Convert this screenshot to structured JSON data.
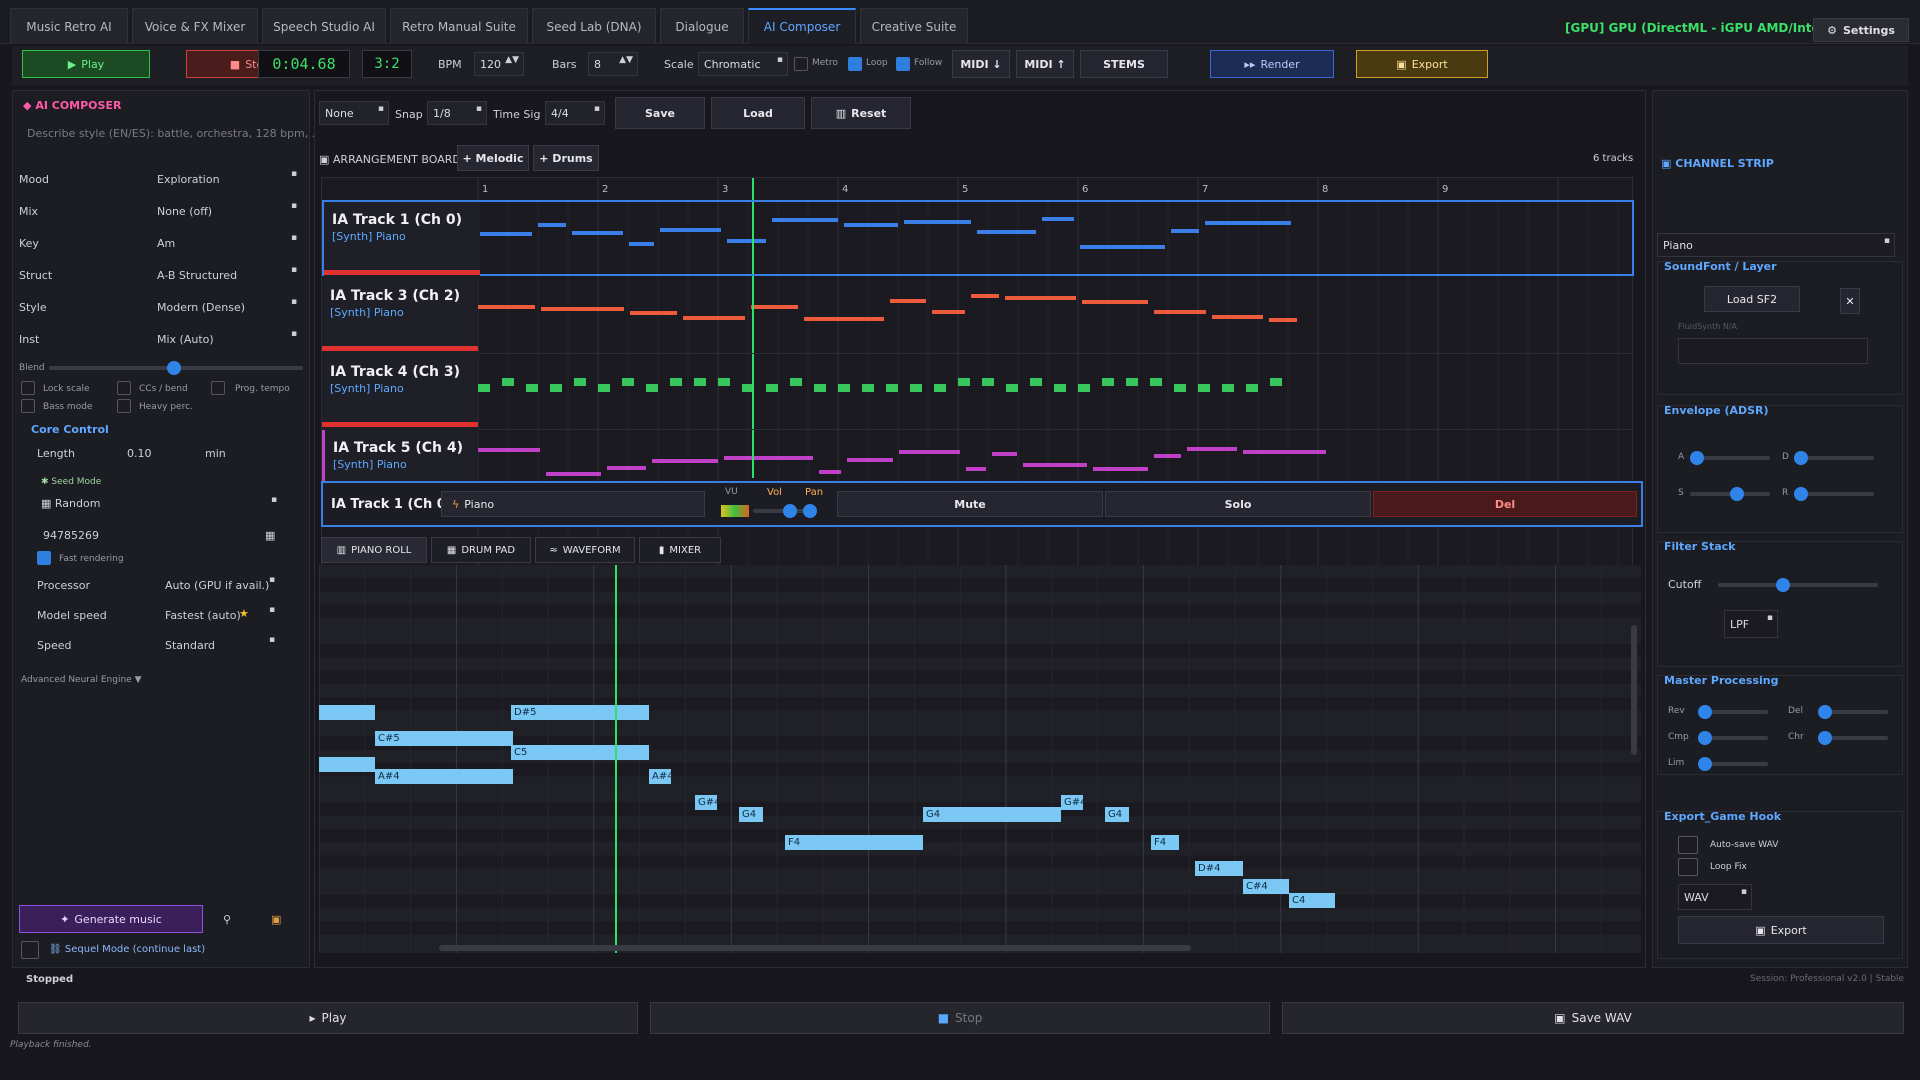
{
  "tabs": [
    {
      "label": "Music Retro AI"
    },
    {
      "label": "Voice & FX Mixer"
    },
    {
      "label": "Speech Studio AI"
    },
    {
      "label": "Retro Manual Suite"
    },
    {
      "label": "Seed Lab (DNA)"
    },
    {
      "label": "Dialogue"
    },
    {
      "label": "AI Composer"
    },
    {
      "label": "Creative Suite"
    }
  ],
  "gpu_status": "[GPU] GPU (DirectML - iGPU AMD/Intel)",
  "settings_label": "Settings",
  "toolbar": {
    "play": "Play",
    "stop": "Stop",
    "time": "0:04.68",
    "ratio": "3:2",
    "bpm_label": "BPM",
    "bpm": "120",
    "bars_label": "Bars",
    "bars": "8",
    "scale_label": "Scale",
    "scale": "Chromatic",
    "metro": "Metro",
    "loop": "Loop",
    "follow": "Follow",
    "midi_in": "MIDI ↓",
    "midi_out": "MIDI ↑",
    "stems": "STEMS",
    "render": "Render",
    "export": "Export"
  },
  "left": {
    "title": "AI COMPOSER",
    "prompt_placeholder": "Describe style (EN/ES): battle, orchestra, 128 bpm, ...",
    "rows": [
      {
        "label": "Mood",
        "value": "Exploration"
      },
      {
        "label": "Mix",
        "value": "None (off)"
      },
      {
        "label": "Key",
        "value": "Am"
      },
      {
        "label": "Struct",
        "value": "A-B Structured"
      },
      {
        "label": "Style",
        "value": "Modern (Dense)"
      },
      {
        "label": "Inst",
        "value": "Mix (Auto)"
      }
    ],
    "blend_label": "Blend",
    "blend_value": 0.5,
    "checks": [
      "Lock scale",
      "CCs / bend",
      "Prog. tempo",
      "Bass mode",
      "Heavy perc."
    ],
    "core_control": "Core Control",
    "length_label": "Length",
    "length_value": "0.10",
    "length_unit": "min",
    "seed_mode": "Seed Mode",
    "seed_type": "Random",
    "seed_value": "94785269",
    "fast_rendering": "Fast rendering",
    "processor_label": "Processor",
    "processor_value": "Auto (GPU if avail.)",
    "model_speed_label": "Model speed",
    "model_speed_value": "Fastest (auto)",
    "speed_label": "Speed",
    "speed_value": "Standard",
    "advanced": "Advanced Neural Engine ▼",
    "generate": "Generate music",
    "sequel": "Sequel Mode (continue last)"
  },
  "center": {
    "preset": "None",
    "snap_label": "Snap",
    "snap": "1/8",
    "timesig_label": "Time Sig",
    "timesig": "4/4",
    "save": "Save",
    "load": "Load",
    "reset": "Reset",
    "arrangement": "ARRANGEMENT BOARD",
    "melodic": "+ Melodic",
    "drums": "+ Drums",
    "track_count": "6 tracks",
    "bars": [
      "1",
      "2",
      "3",
      "4",
      "5",
      "6",
      "7",
      "8",
      "9"
    ],
    "tracks": [
      {
        "title": "IA Track 1 (Ch 0)",
        "sub": "[Synth] Piano",
        "color": "#3a7fe6"
      },
      {
        "title": "IA Track 3 (Ch 2)",
        "sub": "[Synth] Piano",
        "color": "#ee5a3c"
      },
      {
        "title": "IA Track 4 (Ch 3)",
        "sub": "[Synth] Piano",
        "color": "#38c65c"
      },
      {
        "title": "IA Track 5 (Ch 4)",
        "sub": "[Synth] Piano",
        "color": "#c040c8"
      }
    ],
    "selected": {
      "title": "IA Track 1 (Ch 0)",
      "instrument": "Piano",
      "vu": "VU",
      "vol": "Vol",
      "pan": "Pan",
      "mute": "Mute",
      "solo": "Solo",
      "del": "Del"
    },
    "subtabs": [
      "PIANO ROLL",
      "DRUM PAD",
      "WAVEFORM",
      "MIXER"
    ],
    "notes": [
      {
        "label": ""
      },
      {
        "label": "D#5"
      },
      {
        "label": "C#5"
      },
      {
        "label": "C5"
      },
      {
        "label": ""
      },
      {
        "label": "A#4"
      },
      {
        "label": "A#4"
      },
      {
        "label": "G#4"
      },
      {
        "label": "G4"
      },
      {
        "label": "G4"
      },
      {
        "label": "G#4"
      },
      {
        "label": "G4"
      },
      {
        "label": "F4"
      },
      {
        "label": "F4"
      },
      {
        "label": "D#4"
      },
      {
        "label": "C#4"
      },
      {
        "label": "C4"
      }
    ]
  },
  "right": {
    "channel_strip": "CHANNEL STRIP",
    "instrument": "Piano",
    "soundfont": "SoundFont / Layer",
    "load_sf2": "Load SF2",
    "fluid": "FluidSynth N/A",
    "envelope": "Envelope (ADSR)",
    "env_labels": [
      "A",
      "D",
      "S",
      "R"
    ],
    "filter": "Filter Stack",
    "cutoff": "Cutoff",
    "filter_type": "LPF",
    "master": "Master Processing",
    "master_labels": [
      "Rev",
      "Del",
      "Cmp",
      "Chr",
      "Lim"
    ],
    "export_hook": "Export_Game Hook",
    "autosave": "Auto-save WAV",
    "loopfix": "Loop Fix",
    "format": "WAV",
    "export": "Export"
  },
  "status": {
    "state": "Stopped",
    "session": "Session: Professional v2.0 | Stable",
    "bottom_play": "Play",
    "bottom_stop": "Stop",
    "bottom_save": "Save WAV",
    "footer": "Playback finished."
  }
}
